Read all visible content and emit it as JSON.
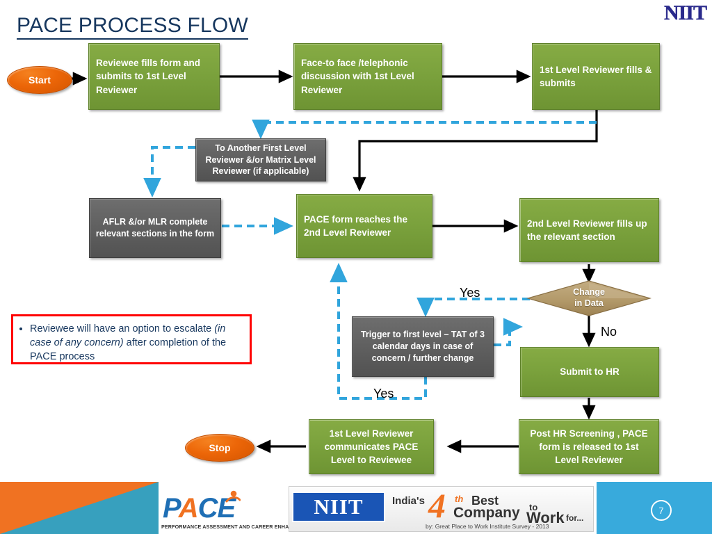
{
  "slide": {
    "title": "PACE PROCESS FLOW",
    "brand_top_right": "NIIT",
    "page_number": "7"
  },
  "colors": {
    "title_blue": "#17375E",
    "process_green": "#7BA23D",
    "process_gray": "#616161",
    "terminator_orange": "#EC6608",
    "decision_tan": "#B59A6B",
    "dashed_blue": "#31A5DC",
    "note_border_red": "#FF0000",
    "footer_orange": "#F07222",
    "footer_teal": "#37A0BE",
    "footer_blue": "#38AADC"
  },
  "nodes": {
    "start": {
      "label": "Start",
      "shape": "ellipse",
      "color": "orange"
    },
    "stop": {
      "label": "Stop",
      "shape": "ellipse",
      "color": "orange"
    },
    "reviewee_fills": {
      "label": "Reviewee fills  form and submits to 1st Level Reviewer",
      "shape": "process",
      "color": "green"
    },
    "face_to_face": {
      "label": "Face-to face /telephonic discussion with 1st Level Reviewer",
      "shape": "process",
      "color": "green"
    },
    "first_level_fills": {
      "label": "1st Level Reviewer fills & submits",
      "shape": "process",
      "color": "green"
    },
    "to_another_flr": {
      "label": "To Another First Level Reviewer &/or Matrix Level Reviewer (if applicable)",
      "shape": "process",
      "color": "gray"
    },
    "aflr_mlr": {
      "label": "AFLR &/or MLR complete relevant sections in the form",
      "shape": "process",
      "color": "gray"
    },
    "pace_form_reaches": {
      "label": "PACE form reaches the 2nd Level Reviewer",
      "shape": "process",
      "color": "green"
    },
    "second_level_fills": {
      "label": "2nd Level Reviewer fills up the relevant section",
      "shape": "process",
      "color": "green"
    },
    "change_in_data": {
      "label_line1": "Change",
      "label_line2": "in Data",
      "shape": "decision",
      "color": "tan"
    },
    "trigger_first_level": {
      "label": "Trigger to first level – TAT of 3 calendar days in case of concern / further change",
      "shape": "process",
      "color": "gray"
    },
    "submit_to_hr": {
      "label": "Submit to HR",
      "shape": "process",
      "color": "green"
    },
    "post_hr_screening": {
      "label": "Post HR Screening , PACE form  is released to 1st Level Reviewer",
      "shape": "process",
      "color": "green"
    },
    "first_level_communicates": {
      "label": "1st Level Reviewer communicates PACE Level to Reviewee",
      "shape": "process",
      "color": "green"
    }
  },
  "connector_labels": {
    "yes_top": "Yes",
    "no": "No",
    "yes_bottom": "Yes"
  },
  "note": {
    "bullet_prefix": "Reviewee will have an option to escalate ",
    "bullet_italic": "(in case of any concern)",
    "bullet_suffix": " after completion of the PACE process"
  },
  "footer": {
    "pace_logo_text": "PACE",
    "pace_tagline": "PERFORMANCE ASSESSMENT AND CAREER ENHANCEMENT",
    "niit_logo_text": "NIIT",
    "banner_indias": "India's",
    "banner_four": "4",
    "banner_th": "th",
    "banner_best": "Best",
    "banner_company": "Company",
    "banner_to": "to",
    "banner_work": "Work",
    "banner_for": "for...",
    "banner_credit": "by: Great Place to Work Institute Survey - 2013"
  }
}
